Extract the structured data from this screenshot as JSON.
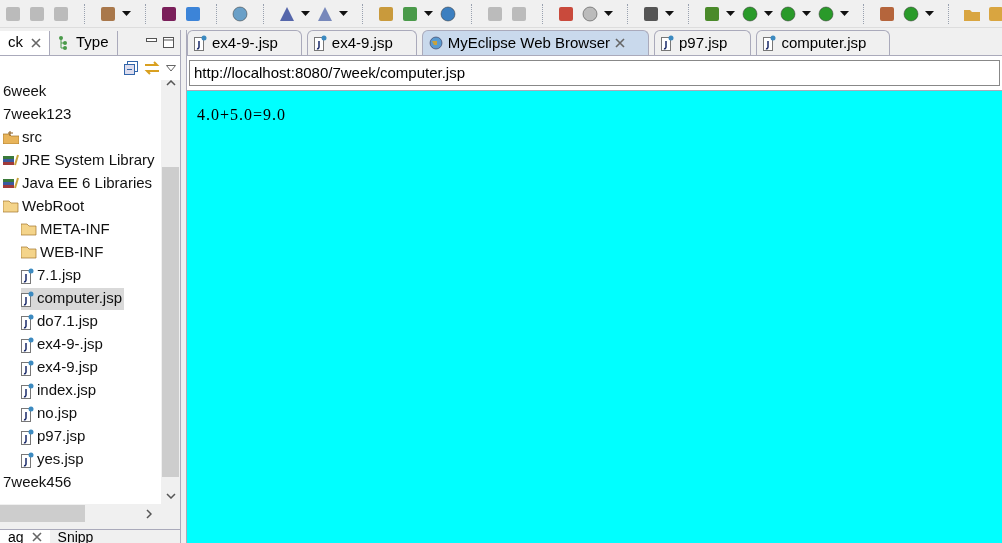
{
  "left_panel": {
    "tabs": [
      {
        "label": "ck",
        "selected": true,
        "closable": true
      },
      {
        "label": "Type",
        "selected": false,
        "closable": false
      }
    ],
    "tree": [
      {
        "label": "6week",
        "selected": false
      },
      {
        "label": "7week123",
        "selected": false,
        "children": [
          {
            "label": "src",
            "kind": "package-folder",
            "selected": false
          },
          {
            "label": "JRE System Library",
            "kind": "library",
            "selected": false
          },
          {
            "label": "Java EE 6 Libraries",
            "kind": "library",
            "selected": false
          },
          {
            "label": "WebRoot",
            "kind": "folder",
            "selected": false,
            "children": [
              {
                "label": "META-INF",
                "kind": "folder",
                "selected": false
              },
              {
                "label": "WEB-INF",
                "kind": "folder",
                "selected": false
              },
              {
                "label": "7.1.jsp",
                "kind": "jsp",
                "selected": false
              },
              {
                "label": "computer.jsp",
                "kind": "jsp",
                "selected": true
              },
              {
                "label": "do7.1.jsp",
                "kind": "jsp",
                "selected": false
              },
              {
                "label": "ex4-9-.jsp",
                "kind": "jsp",
                "selected": false
              },
              {
                "label": "ex4-9.jsp",
                "kind": "jsp",
                "selected": false
              },
              {
                "label": "index.jsp",
                "kind": "jsp",
                "selected": false
              },
              {
                "label": "no.jsp",
                "kind": "jsp",
                "selected": false
              },
              {
                "label": "p97.jsp",
                "kind": "jsp",
                "selected": false
              },
              {
                "label": "yes.jsp",
                "kind": "jsp",
                "selected": false
              }
            ]
          }
        ]
      },
      {
        "label": "7week456",
        "selected": false
      }
    ]
  },
  "bottom_panel": {
    "tabs": [
      {
        "label": "ag",
        "selected": true,
        "closable": true
      },
      {
        "label": "Snipp",
        "selected": false,
        "closable": false
      }
    ]
  },
  "editor": {
    "tabs": [
      {
        "label": "ex4-9-.jsp",
        "kind": "jsp",
        "selected": false,
        "closable": false
      },
      {
        "label": "ex4-9.jsp",
        "kind": "jsp",
        "selected": false,
        "closable": false
      },
      {
        "label": "MyEclipse Web Browser",
        "kind": "browser",
        "selected": true,
        "closable": true
      },
      {
        "label": "p97.jsp",
        "kind": "jsp",
        "selected": false,
        "closable": false
      },
      {
        "label": "computer.jsp",
        "kind": "jsp",
        "selected": false,
        "closable": false
      }
    ],
    "url": "http://localhost:8080/7week/computer.jsp",
    "page_text": "4.0+5.0=9.0"
  }
}
